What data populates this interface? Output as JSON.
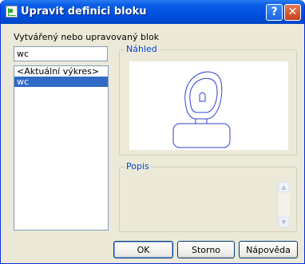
{
  "window": {
    "title": "Upravit definici bloku"
  },
  "block_label": "Vytvářený nebo upravovaný blok",
  "name_input": {
    "value": "wc"
  },
  "block_list": {
    "items": [
      {
        "label": "<Aktuální výkres>",
        "selected": false
      },
      {
        "label": "wc",
        "selected": true
      }
    ]
  },
  "preview": {
    "caption": "Náhled"
  },
  "description": {
    "caption": "Popis"
  },
  "buttons": {
    "ok": "OK",
    "cancel": "Storno",
    "help": "Nápověda"
  },
  "titlebar_buttons": {
    "help": "?",
    "close": "✕"
  },
  "colors": {
    "preview_line": "#3040d0",
    "selection": "#316ac5",
    "group_caption": "#0046d5"
  }
}
